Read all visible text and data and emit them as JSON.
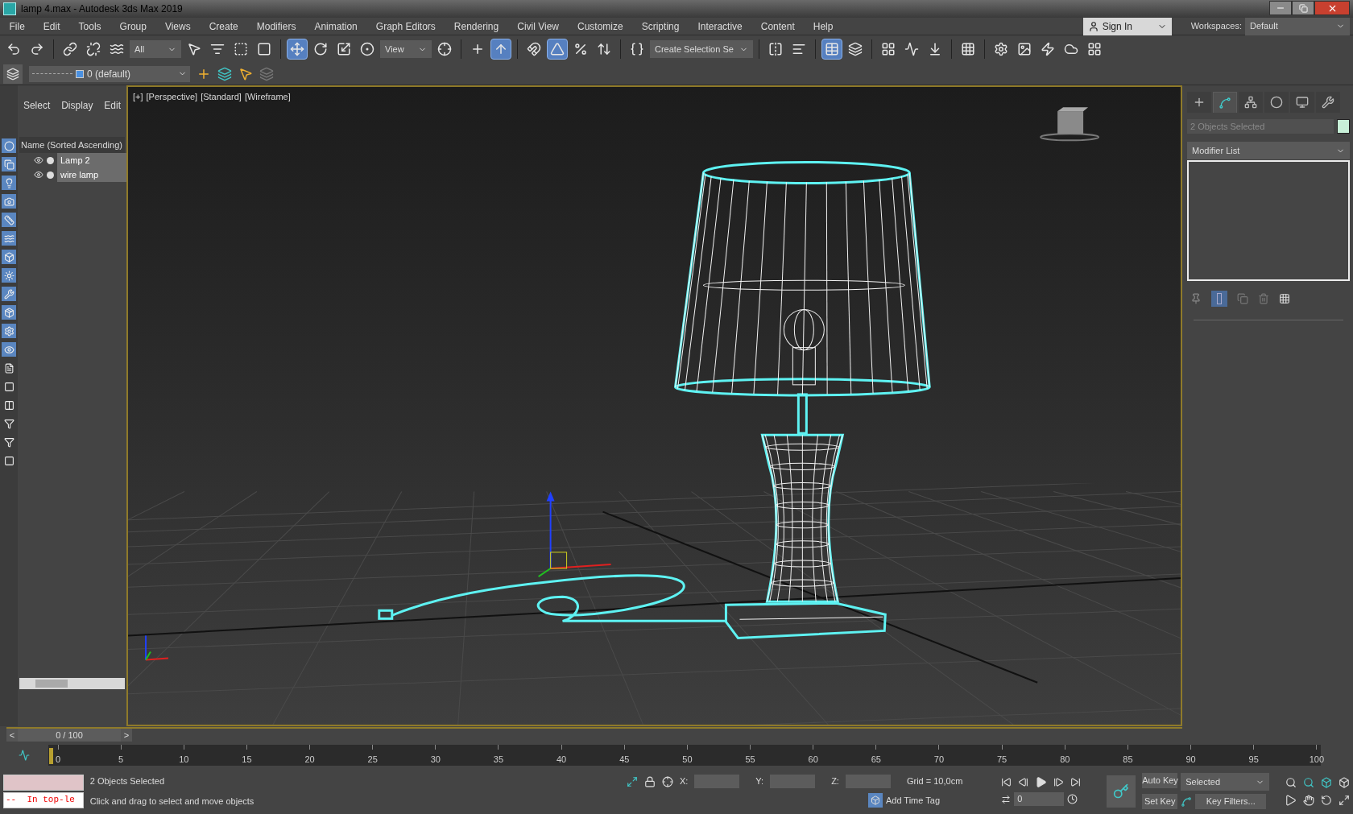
{
  "window": {
    "title": "lamp 4.max - Autodesk 3ds Max 2019"
  },
  "menu": [
    "File",
    "Edit",
    "Tools",
    "Group",
    "Views",
    "Create",
    "Modifiers",
    "Animation",
    "Graph Editors",
    "Rendering",
    "Civil View",
    "Customize",
    "Scripting",
    "Interactive",
    "Content",
    "Help"
  ],
  "account": {
    "sign_in": "Sign In"
  },
  "workspaces": {
    "label": "Workspaces:",
    "value": "Default"
  },
  "toolbar": {
    "items": [
      {
        "kind": "undo",
        "active": false
      },
      {
        "kind": "redo",
        "active": false
      },
      {
        "kind": "sep"
      },
      {
        "kind": "link",
        "active": false
      },
      {
        "kind": "unlink",
        "active": false
      },
      {
        "kind": "bind",
        "active": false
      },
      {
        "kind": "dropdown",
        "value": "All"
      },
      {
        "kind": "select",
        "active": false
      },
      {
        "kind": "select_by_name",
        "active": false
      },
      {
        "kind": "region",
        "active": false
      },
      {
        "kind": "crossing",
        "active": false
      },
      {
        "kind": "sep"
      },
      {
        "kind": "move",
        "active": true
      },
      {
        "kind": "rotate",
        "active": false
      },
      {
        "kind": "scale",
        "active": false
      },
      {
        "kind": "placement",
        "active": false
      },
      {
        "kind": "dropdown",
        "value": "View"
      },
      {
        "kind": "pivot",
        "active": false
      },
      {
        "kind": "sep"
      },
      {
        "kind": "manipulate",
        "active": false
      },
      {
        "kind": "shortcut",
        "active": true
      },
      {
        "kind": "sep"
      },
      {
        "kind": "snap",
        "active": false
      },
      {
        "kind": "angle",
        "active": true
      },
      {
        "kind": "percent",
        "active": false
      },
      {
        "kind": "spinner",
        "active": false
      },
      {
        "kind": "sep"
      },
      {
        "kind": "named_sets",
        "active": false
      },
      {
        "kind": "dropdown",
        "value": "Create Selection Se"
      },
      {
        "kind": "sep"
      },
      {
        "kind": "mirror",
        "active": false
      },
      {
        "kind": "align",
        "active": false
      },
      {
        "kind": "sep"
      },
      {
        "kind": "explorer",
        "active": true
      },
      {
        "kind": "layers",
        "active": false
      },
      {
        "kind": "sep"
      },
      {
        "kind": "ribbon",
        "active": false
      },
      {
        "kind": "curve",
        "active": false
      },
      {
        "kind": "schematic",
        "active": false
      },
      {
        "kind": "sep"
      },
      {
        "kind": "material",
        "active": false
      },
      {
        "kind": "sep"
      },
      {
        "kind": "render_setup",
        "active": false
      },
      {
        "kind": "frame_window",
        "active": false
      },
      {
        "kind": "render",
        "active": false
      },
      {
        "kind": "cloud",
        "active": false
      },
      {
        "kind": "gallery",
        "active": false
      }
    ]
  },
  "layer_bar": {
    "current_layer": "0 (default)"
  },
  "scene_explorer": {
    "tabs": [
      {
        "label": "Select"
      },
      {
        "label": "Display"
      },
      {
        "label": "Edit"
      }
    ],
    "column": "Name (Sorted Ascending)",
    "items": [
      {
        "name": "Lamp 2",
        "selected": true
      },
      {
        "name": "wire lamp",
        "selected": true
      }
    ]
  },
  "viewport": {
    "labels": [
      "[+]",
      "[Perspective]",
      "[Standard]",
      "[Wireframe]"
    ]
  },
  "command_panel": {
    "tabs": [
      {
        "kind": "create",
        "selected": false
      },
      {
        "kind": "modify",
        "selected": true
      },
      {
        "kind": "hierarchy",
        "selected": false
      },
      {
        "kind": "motion",
        "selected": false
      },
      {
        "kind": "display",
        "selected": false
      },
      {
        "kind": "utilities",
        "selected": false
      }
    ],
    "object_name": "2 Objects Selected",
    "modifier_list": "Modifier List"
  },
  "time_slider": {
    "prev": "<",
    "position": "0 / 100",
    "next": ">",
    "level": 0
  },
  "track_bar": {
    "ticks": [
      "0",
      "5",
      "10",
      "15",
      "20",
      "25",
      "30",
      "35",
      "40",
      "45",
      "50",
      "55",
      "60",
      "65",
      "70",
      "75",
      "80",
      "85",
      "90",
      "95",
      "100"
    ]
  },
  "status": {
    "maxscript": "--  In top-le",
    "selection": "2 Objects Selected",
    "prompt": "Click and drag to select and move objects",
    "x_label": "X:",
    "y_label": "Y:",
    "z_label": "Z:",
    "grid": "Grid = 10,0cm",
    "add_time_tag": "Add Time Tag"
  },
  "animation": {
    "current_frame": "0",
    "auto_key": "Auto Key",
    "key_mode": "Selected",
    "set_key": "Set Key",
    "key_filters": "Key Filters..."
  }
}
